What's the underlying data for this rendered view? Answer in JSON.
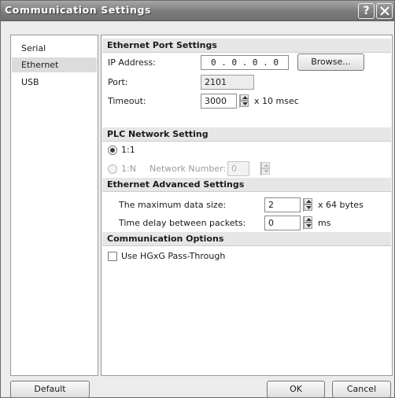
{
  "window": {
    "title": "Communication Settings",
    "help_glyph": "?"
  },
  "sidebar": {
    "items": [
      {
        "label": "Serial"
      },
      {
        "label": "Ethernet"
      },
      {
        "label": "USB"
      }
    ],
    "selected": "Ethernet"
  },
  "ethernet_port": {
    "heading": "Ethernet Port Settings",
    "ip_label": "IP Address:",
    "ip_value": "0 . 0 . 0 . 0",
    "browse_label": "Browse...",
    "port_label": "Port:",
    "port_value": "2101",
    "timeout_label": "Timeout:",
    "timeout_value": "3000",
    "timeout_unit": "x 10 msec"
  },
  "plc_network": {
    "heading": "PLC Network Setting",
    "option_1_1": "1:1",
    "option_1_n": "1:N",
    "network_number_label": "Network Number:",
    "network_number_value": "0",
    "selected": "1:1"
  },
  "ethernet_advanced": {
    "heading": "Ethernet Advanced Settings",
    "max_data_label": "The maximum data size:",
    "max_data_value": "2",
    "max_data_unit": "x 64 bytes",
    "delay_label": "Time delay between packets:",
    "delay_value": "0",
    "delay_unit": "ms"
  },
  "comm_options": {
    "heading": "Communication Options",
    "passthrough_label": "Use HGxG Pass-Through",
    "passthrough_checked": false
  },
  "footer": {
    "default_label": "Default",
    "ok_label": "OK",
    "cancel_label": "Cancel"
  }
}
